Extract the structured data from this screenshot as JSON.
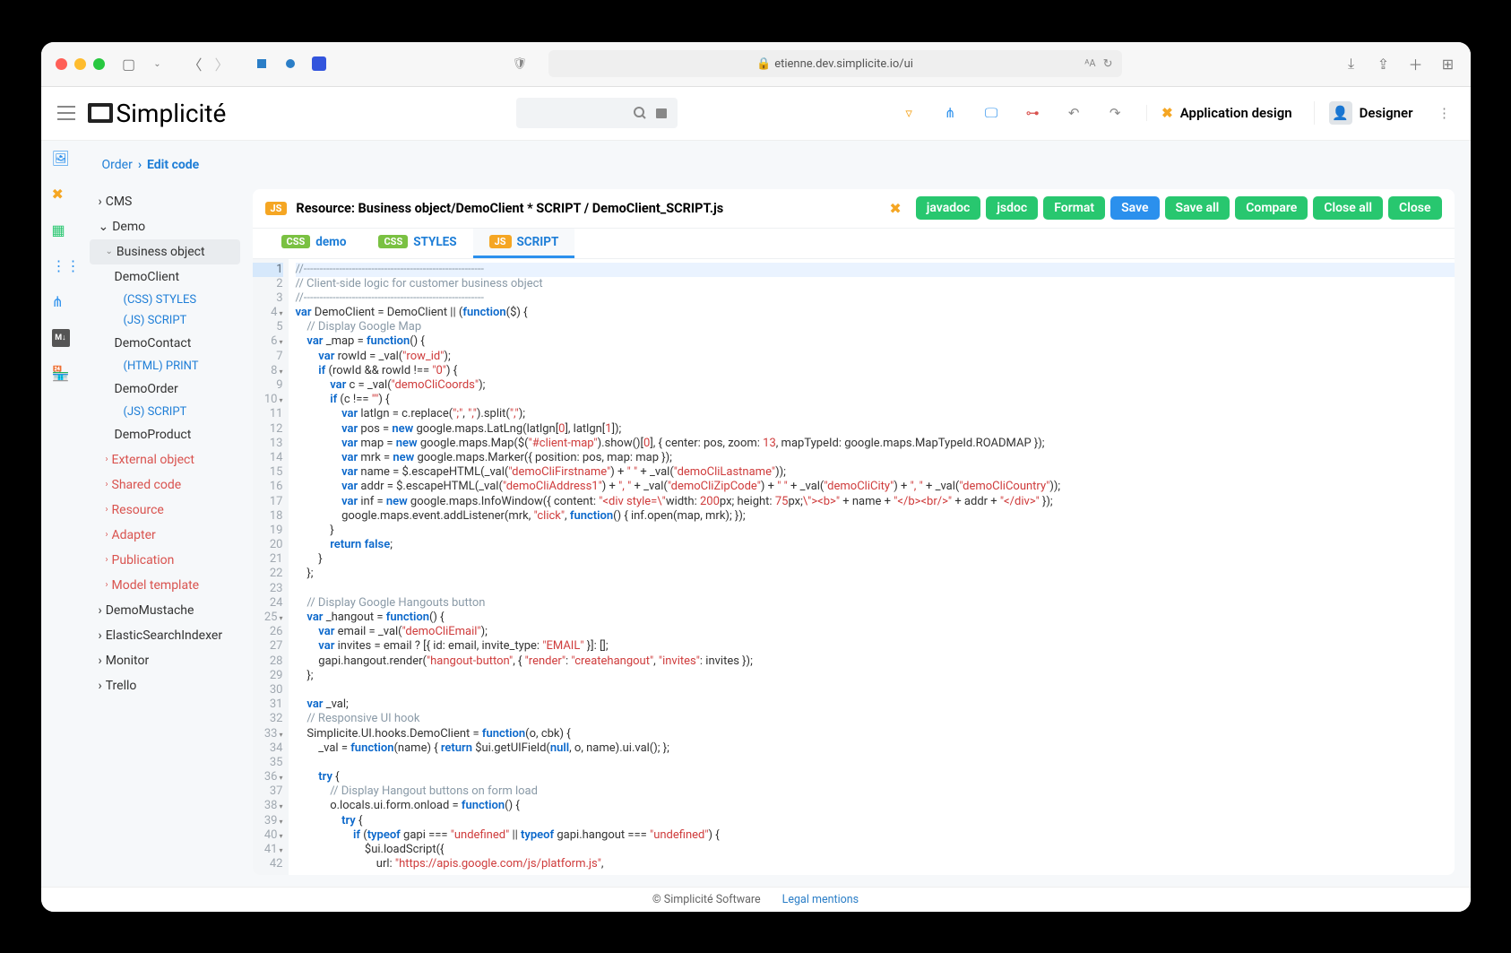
{
  "window": {
    "url": "etienne.dev.simplicite.io/ui"
  },
  "header": {
    "logo_text": "Simplicité",
    "app_design": "Application design",
    "user_role": "Designer"
  },
  "breadcrumb": {
    "root": "Order",
    "current": "Edit code"
  },
  "sidebar": {
    "sections": [
      {
        "label": "CMS",
        "expanded": false
      },
      {
        "label": "Demo",
        "expanded": true,
        "children": [
          {
            "label": "Business object",
            "selected": true,
            "children": [
              {
                "label": "DemoClient",
                "leaves": [
                  "(CSS) STYLES",
                  "(JS) SCRIPT"
                ]
              },
              {
                "label": "DemoContact",
                "leaves": [
                  "(HTML) PRINT"
                ]
              },
              {
                "label": "DemoOrder",
                "leaves": [
                  "(JS) SCRIPT"
                ]
              },
              {
                "label": "DemoProduct",
                "leaves": []
              }
            ]
          },
          {
            "label": "External object",
            "red": true
          },
          {
            "label": "Shared code",
            "red": true
          },
          {
            "label": "Resource",
            "red": true
          },
          {
            "label": "Adapter",
            "red": true
          },
          {
            "label": "Publication",
            "red": true
          },
          {
            "label": "Model template",
            "red": true
          }
        ]
      },
      {
        "label": "DemoMustache",
        "expanded": false
      },
      {
        "label": "ElasticSearchIndexer",
        "expanded": false
      },
      {
        "label": "Monitor",
        "expanded": false
      },
      {
        "label": "Trello",
        "expanded": false
      }
    ]
  },
  "editor": {
    "title": "Resource: Business object/DemoClient * SCRIPT / DemoClient_SCRIPT.js",
    "buttons": [
      "javadoc",
      "jsdoc",
      "Format",
      "Save",
      "Save all",
      "Compare",
      "Close all",
      "Close"
    ],
    "tabs": [
      {
        "label": "demo",
        "badge": "css"
      },
      {
        "label": "STYLES",
        "badge": "css"
      },
      {
        "label": "SCRIPT",
        "badge": "js",
        "active": true
      }
    ],
    "line_count": 42,
    "highlight_line": 1,
    "code_lines": [
      {
        "n": 1,
        "t": "com",
        "s": "//--------------------------------------------------------"
      },
      {
        "n": 2,
        "t": "com",
        "s": "// Client-side logic for customer business object"
      },
      {
        "n": 3,
        "t": "com",
        "s": "//--------------------------------------------------------"
      },
      {
        "n": 4,
        "fold": true,
        "seg": [
          [
            "kw",
            "var"
          ],
          [
            "",
            " DemoClient = DemoClient || ("
          ],
          [
            "kw",
            "function"
          ],
          [
            "",
            "($) {"
          ]
        ]
      },
      {
        "n": 5,
        "seg": [
          [
            "",
            "    "
          ],
          [
            "com",
            "// Display Google Map"
          ]
        ]
      },
      {
        "n": 6,
        "fold": true,
        "seg": [
          [
            "",
            "    "
          ],
          [
            "kw",
            "var"
          ],
          [
            "",
            " _map = "
          ],
          [
            "kw",
            "function"
          ],
          [
            "",
            "() {"
          ]
        ]
      },
      {
        "n": 7,
        "seg": [
          [
            "",
            "        "
          ],
          [
            "kw",
            "var"
          ],
          [
            "",
            " rowId = _val("
          ],
          [
            "str",
            "\"row_id\""
          ],
          [
            "",
            ");"
          ]
        ]
      },
      {
        "n": 8,
        "fold": true,
        "seg": [
          [
            "",
            "        "
          ],
          [
            "kw",
            "if"
          ],
          [
            "",
            " (rowId && rowId !== "
          ],
          [
            "str",
            "\"0\""
          ],
          [
            "",
            ") {"
          ]
        ]
      },
      {
        "n": 9,
        "seg": [
          [
            "",
            "            "
          ],
          [
            "kw",
            "var"
          ],
          [
            "",
            " c = _val("
          ],
          [
            "str",
            "\"demoCliCoords\""
          ],
          [
            "",
            ");"
          ]
        ]
      },
      {
        "n": 10,
        "fold": true,
        "seg": [
          [
            "",
            "            "
          ],
          [
            "kw",
            "if"
          ],
          [
            "",
            " (c !== "
          ],
          [
            "str",
            "\"\""
          ],
          [
            "",
            ") {"
          ]
        ]
      },
      {
        "n": 11,
        "seg": [
          [
            "",
            "                "
          ],
          [
            "kw",
            "var"
          ],
          [
            "",
            " latlgn = c.replace("
          ],
          [
            "str",
            "\";\""
          ],
          [
            "",
            ", "
          ],
          [
            "str",
            "\",\""
          ],
          [
            "",
            ").split("
          ],
          [
            "str",
            "\",\""
          ],
          [
            "",
            ");"
          ]
        ]
      },
      {
        "n": 12,
        "seg": [
          [
            "",
            "                "
          ],
          [
            "kw",
            "var"
          ],
          [
            "",
            " pos = "
          ],
          [
            "kw",
            "new"
          ],
          [
            "",
            " google.maps.LatLng(latlgn["
          ],
          [
            "num",
            "0"
          ],
          [
            "",
            "], latlgn["
          ],
          [
            "num",
            "1"
          ],
          [
            "",
            "]);"
          ]
        ]
      },
      {
        "n": 13,
        "seg": [
          [
            "",
            "                "
          ],
          [
            "kw",
            "var"
          ],
          [
            "",
            " map = "
          ],
          [
            "kw",
            "new"
          ],
          [
            "",
            " google.maps.Map($("
          ],
          [
            "str",
            "\"#client-map\""
          ],
          [
            "",
            ").show()["
          ],
          [
            "num",
            "0"
          ],
          [
            "",
            "], { center: pos, zoom: "
          ],
          [
            "num",
            "13"
          ],
          [
            "",
            ", mapTypeId: google.maps.MapTypeId.ROADMAP });"
          ]
        ]
      },
      {
        "n": 14,
        "seg": [
          [
            "",
            "                "
          ],
          [
            "kw",
            "var"
          ],
          [
            "",
            " mrk = "
          ],
          [
            "kw",
            "new"
          ],
          [
            "",
            " google.maps.Marker({ position: pos, map: map });"
          ]
        ]
      },
      {
        "n": 15,
        "seg": [
          [
            "",
            "                "
          ],
          [
            "kw",
            "var"
          ],
          [
            "",
            " name = $.escapeHTML(_val("
          ],
          [
            "str",
            "\"demoCliFirstname\""
          ],
          [
            "",
            ") + "
          ],
          [
            "str",
            "\" \""
          ],
          [
            "",
            " + _val("
          ],
          [
            "str",
            "\"demoCliLastname\""
          ],
          [
            "",
            "));"
          ]
        ]
      },
      {
        "n": 16,
        "seg": [
          [
            "",
            "                "
          ],
          [
            "kw",
            "var"
          ],
          [
            "",
            " addr = $.escapeHTML(_val("
          ],
          [
            "str",
            "\"demoCliAddress1\""
          ],
          [
            "",
            ") + "
          ],
          [
            "str",
            "\", \""
          ],
          [
            "",
            " + _val("
          ],
          [
            "str",
            "\"demoCliZipCode\""
          ],
          [
            "",
            ") + "
          ],
          [
            "str",
            "\" \""
          ],
          [
            "",
            " + _val("
          ],
          [
            "str",
            "\"demoCliCity\""
          ],
          [
            "",
            ") + "
          ],
          [
            "str",
            "\", \""
          ],
          [
            "",
            " + _val("
          ],
          [
            "str",
            "\"demoCliCountry\""
          ],
          [
            "",
            "));"
          ]
        ]
      },
      {
        "n": 17,
        "seg": [
          [
            "",
            "                "
          ],
          [
            "kw",
            "var"
          ],
          [
            "",
            " inf = "
          ],
          [
            "kw",
            "new"
          ],
          [
            "",
            " google.maps.InfoWindow({ content: "
          ],
          [
            "str",
            "\"<div style=\\\""
          ],
          [
            "",
            "width: "
          ],
          [
            "num",
            "200"
          ],
          [
            "",
            "px; height: "
          ],
          [
            "num",
            "75"
          ],
          [
            "",
            "px;"
          ],
          [
            "str",
            "\\\"><b>\""
          ],
          [
            "",
            " + name + "
          ],
          [
            "str",
            "\"</b><br/>\""
          ],
          [
            "",
            " + addr + "
          ],
          [
            "str",
            "\"</div>\""
          ],
          [
            "",
            " });"
          ]
        ]
      },
      {
        "n": 18,
        "seg": [
          [
            "",
            "                google.maps.event.addListener(mrk, "
          ],
          [
            "str",
            "\"click\""
          ],
          [
            "",
            ", "
          ],
          [
            "kw",
            "function"
          ],
          [
            "",
            "() { inf.open(map, mrk); });"
          ]
        ]
      },
      {
        "n": 19,
        "seg": [
          [
            "",
            "            }"
          ]
        ]
      },
      {
        "n": 20,
        "seg": [
          [
            "",
            "            "
          ],
          [
            "kw",
            "return"
          ],
          [
            "",
            " "
          ],
          [
            "kw",
            "false"
          ],
          [
            "",
            ";"
          ]
        ]
      },
      {
        "n": 21,
        "seg": [
          [
            "",
            "        }"
          ]
        ]
      },
      {
        "n": 22,
        "seg": [
          [
            "",
            "    };"
          ]
        ]
      },
      {
        "n": 23,
        "seg": [
          [
            "",
            ""
          ]
        ]
      },
      {
        "n": 24,
        "seg": [
          [
            "",
            "    "
          ],
          [
            "com",
            "// Display Google Hangouts button"
          ]
        ]
      },
      {
        "n": 25,
        "fold": true,
        "seg": [
          [
            "",
            "    "
          ],
          [
            "kw",
            "var"
          ],
          [
            "",
            " _hangout = "
          ],
          [
            "kw",
            "function"
          ],
          [
            "",
            "() {"
          ]
        ]
      },
      {
        "n": 26,
        "seg": [
          [
            "",
            "        "
          ],
          [
            "kw",
            "var"
          ],
          [
            "",
            " email = _val("
          ],
          [
            "str",
            "\"demoCliEmail\""
          ],
          [
            "",
            ");"
          ]
        ]
      },
      {
        "n": 27,
        "seg": [
          [
            "",
            "        "
          ],
          [
            "kw",
            "var"
          ],
          [
            "",
            " invites = email ? [{ id: email, invite_type: "
          ],
          [
            "str",
            "\"EMAIL\""
          ],
          [
            "",
            " }]: [];"
          ]
        ]
      },
      {
        "n": 28,
        "seg": [
          [
            "",
            "        gapi.hangout.render("
          ],
          [
            "str",
            "\"hangout-button\""
          ],
          [
            "",
            ", { "
          ],
          [
            "str",
            "\"render\""
          ],
          [
            "",
            ": "
          ],
          [
            "str",
            "\"createhangout\""
          ],
          [
            "",
            ", "
          ],
          [
            "str",
            "\"invites\""
          ],
          [
            "",
            ": invites });"
          ]
        ]
      },
      {
        "n": 29,
        "seg": [
          [
            "",
            "    };"
          ]
        ]
      },
      {
        "n": 30,
        "seg": [
          [
            "",
            ""
          ]
        ]
      },
      {
        "n": 31,
        "seg": [
          [
            "",
            "    "
          ],
          [
            "kw",
            "var"
          ],
          [
            "",
            " _val;"
          ]
        ]
      },
      {
        "n": 32,
        "seg": [
          [
            "",
            "    "
          ],
          [
            "com",
            "// Responsive UI hook"
          ]
        ]
      },
      {
        "n": 33,
        "fold": true,
        "seg": [
          [
            "",
            "    Simplicite.UI.hooks.DemoClient = "
          ],
          [
            "kw",
            "function"
          ],
          [
            "",
            "(o, cbk) {"
          ]
        ]
      },
      {
        "n": 34,
        "seg": [
          [
            "",
            "        _val = "
          ],
          [
            "kw",
            "function"
          ],
          [
            "",
            "(name) { "
          ],
          [
            "kw",
            "return"
          ],
          [
            "",
            " $ui.getUIField("
          ],
          [
            "kw",
            "null"
          ],
          [
            "",
            ", o, name).ui.val(); };"
          ]
        ]
      },
      {
        "n": 35,
        "seg": [
          [
            "",
            ""
          ]
        ]
      },
      {
        "n": 36,
        "fold": true,
        "seg": [
          [
            "",
            "        "
          ],
          [
            "kw",
            "try"
          ],
          [
            "",
            " {"
          ]
        ]
      },
      {
        "n": 37,
        "seg": [
          [
            "",
            "            "
          ],
          [
            "com",
            "// Display Hangout buttons on form load"
          ]
        ]
      },
      {
        "n": 38,
        "fold": true,
        "seg": [
          [
            "",
            "            o.locals.ui.form.onload = "
          ],
          [
            "kw",
            "function"
          ],
          [
            "",
            "() {"
          ]
        ]
      },
      {
        "n": 39,
        "fold": true,
        "seg": [
          [
            "",
            "                "
          ],
          [
            "kw",
            "try"
          ],
          [
            "",
            " {"
          ]
        ]
      },
      {
        "n": 40,
        "fold": true,
        "seg": [
          [
            "",
            "                    "
          ],
          [
            "kw",
            "if"
          ],
          [
            "",
            " ("
          ],
          [
            "kw",
            "typeof"
          ],
          [
            "",
            " gapi === "
          ],
          [
            "str",
            "\"undefined\""
          ],
          [
            "",
            " || "
          ],
          [
            "kw",
            "typeof"
          ],
          [
            "",
            " gapi.hangout === "
          ],
          [
            "str",
            "\"undefined\""
          ],
          [
            "",
            ") {"
          ]
        ]
      },
      {
        "n": 41,
        "fold": true,
        "seg": [
          [
            "",
            "                        $ui.loadScript({"
          ]
        ]
      },
      {
        "n": 42,
        "seg": [
          [
            "",
            "                            url: "
          ],
          [
            "str",
            "\"https://apis.google.com/js/platform.js\""
          ],
          [
            "",
            ","
          ]
        ]
      }
    ]
  },
  "footer": {
    "copyright": "© Simplicité Software",
    "legal": "Legal mentions"
  }
}
